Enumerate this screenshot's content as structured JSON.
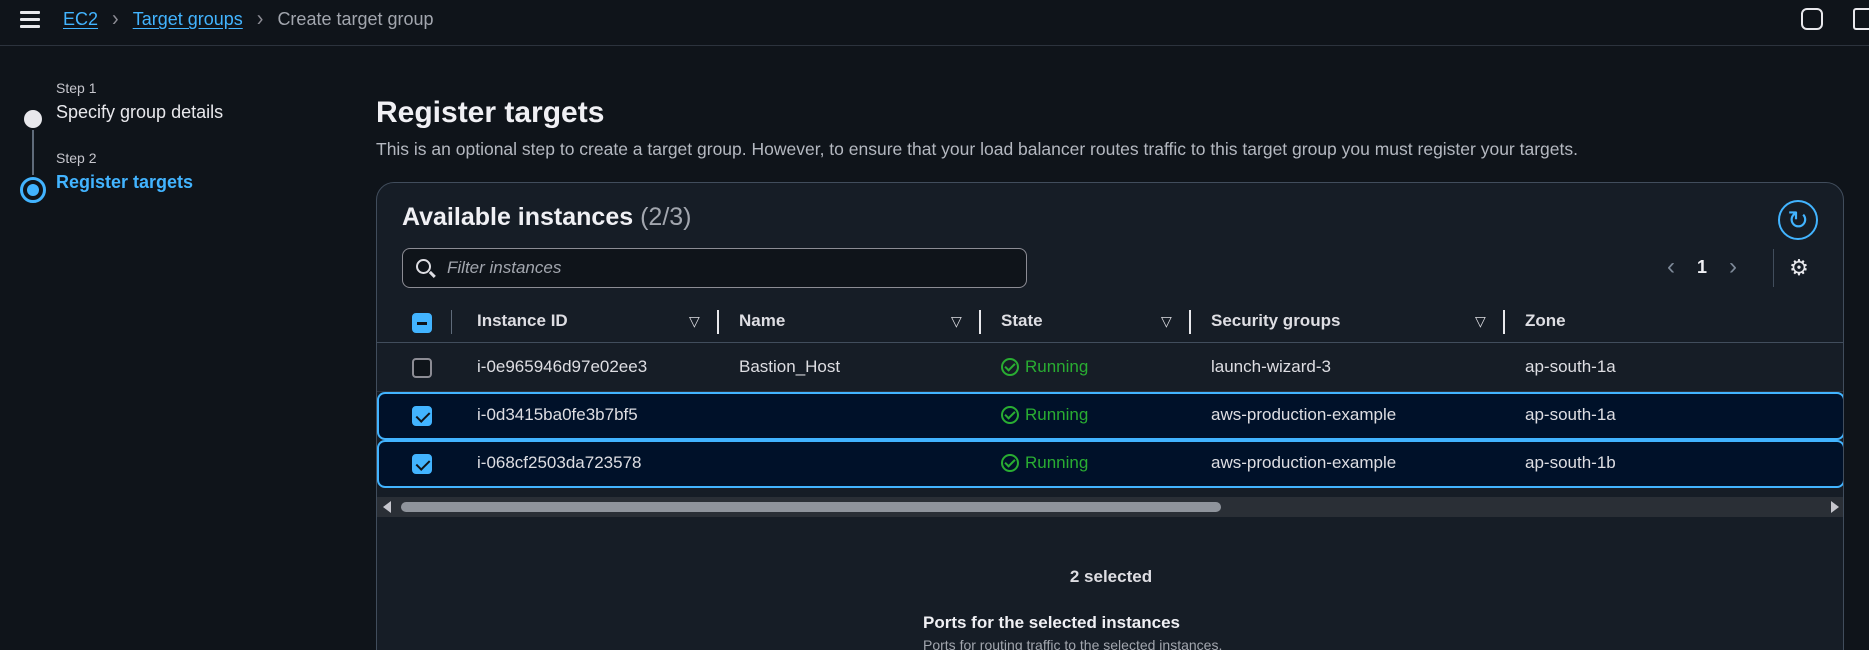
{
  "breadcrumb": {
    "items": [
      "EC2",
      "Target groups"
    ],
    "current": "Create target group"
  },
  "stepper": {
    "steps": [
      {
        "num": "Step 1",
        "title": "Specify group details"
      },
      {
        "num": "Step 2",
        "title": "Register targets"
      }
    ]
  },
  "page": {
    "title": "Register targets",
    "description": "This is an optional step to create a target group. However, to ensure that your load balancer routes traffic to this target group you must register your targets."
  },
  "panel": {
    "title": "Available instances",
    "count": "(2/3)",
    "search_placeholder": "Filter instances",
    "page_number": "1",
    "columns": [
      "Instance ID",
      "Name",
      "State",
      "Security groups",
      "Zone"
    ],
    "rows": [
      {
        "instance_id": "i-0e965946d97e02ee3",
        "name": "Bastion_Host",
        "state": "Running",
        "security_group": "launch-wizard-3",
        "zone": "ap-south-1a",
        "checked": false
      },
      {
        "instance_id": "i-0d3415ba0fe3b7bf5",
        "name": "",
        "state": "Running",
        "security_group": "aws-production-example",
        "zone": "ap-south-1a",
        "checked": true
      },
      {
        "instance_id": "i-068cf2503da723578",
        "name": "",
        "state": "Running",
        "security_group": "aws-production-example",
        "zone": "ap-south-1b",
        "checked": true
      }
    ],
    "selected_count": "2 selected",
    "ports_title": "Ports for the selected instances",
    "ports_desc": "Ports for routing traffic to the selected instances."
  },
  "icons": {
    "menu": "hamburger-icon",
    "help": "help-icon",
    "screen": "screen-icon",
    "refresh": "refresh-icon",
    "settings": "gear-icon",
    "search": "search-icon",
    "status_ok": "check-circle-icon"
  },
  "colors": {
    "accent": "#42b4ff",
    "success": "#29ad32",
    "background": "#0f141a",
    "panel": "#161d26"
  }
}
